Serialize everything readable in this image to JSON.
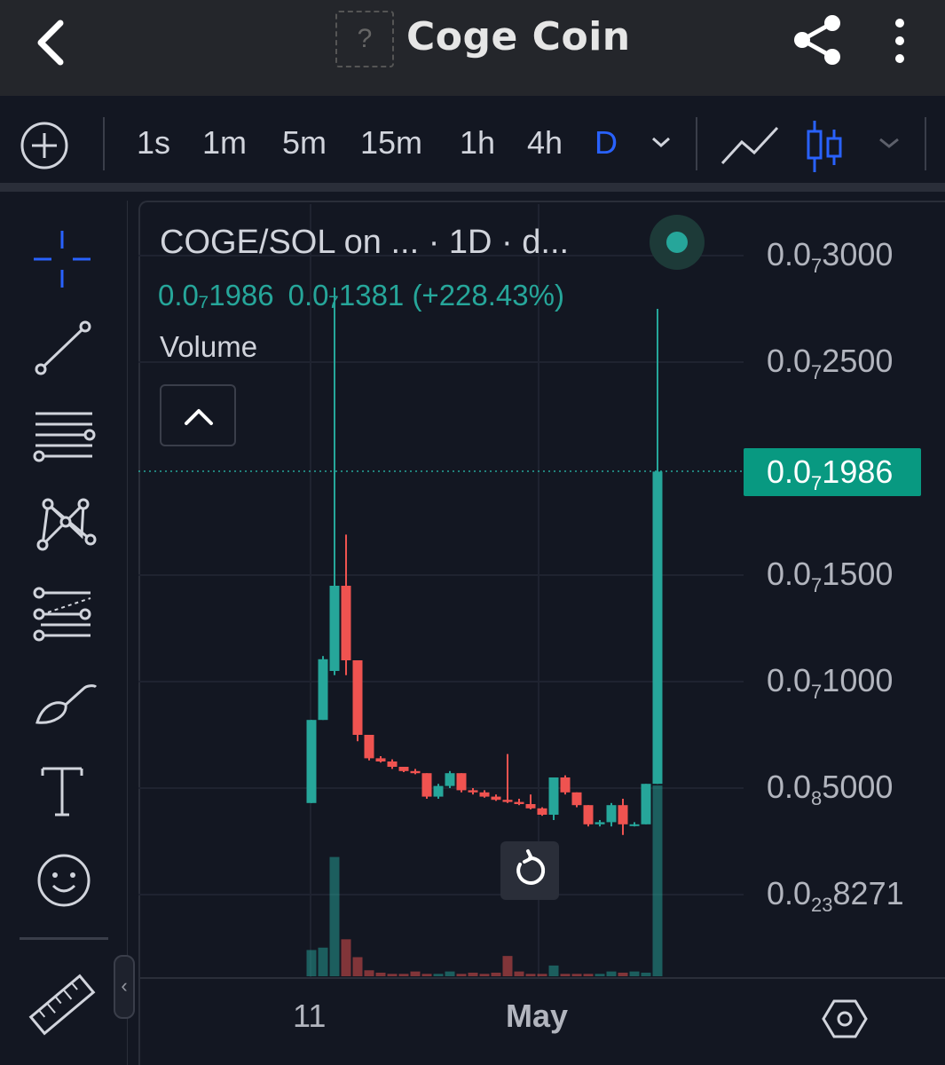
{
  "header": {
    "logo_placeholder": "?",
    "title": "Coge Coin",
    "back_icon": "chevron-left-icon",
    "share_icon": "share-icon",
    "more_icon": "more-vertical-icon"
  },
  "toolbar": {
    "timeframes": [
      "1s",
      "1m",
      "5m",
      "15m",
      "1h",
      "4h",
      "D"
    ],
    "active_timeframe": "D"
  },
  "sidebar": {
    "tools": [
      "crosshair",
      "trend-line",
      "horizontal-lines",
      "pattern",
      "fib-retracement",
      "brush",
      "text",
      "emoji",
      "ruler"
    ],
    "active_tool": "crosshair"
  },
  "legend": {
    "title": "COGE/SOL on ...   · 1D · d...",
    "close_value": "0.0₇1986",
    "change_value": "0.0₇1381 (+228.43%)",
    "volume_label": "Volume"
  },
  "price_axis": {
    "labels": [
      {
        "base": "0.0",
        "sub": "7",
        "rest": "3000"
      },
      {
        "base": "0.0",
        "sub": "7",
        "rest": "2500"
      },
      {
        "base": "0.0",
        "sub": "7",
        "rest": "1500"
      },
      {
        "base": "0.0",
        "sub": "7",
        "rest": "1000"
      },
      {
        "base": "0.0",
        "sub": "8",
        "rest": "5000"
      },
      {
        "base": "0.0",
        "sub": "23",
        "rest": "8271"
      }
    ],
    "current_price": {
      "base": "0.0",
      "sub": "7",
      "rest": "1986"
    }
  },
  "time_axis": {
    "labels": [
      "11",
      "May"
    ]
  },
  "colors": {
    "up": "#26a69a",
    "down": "#ef5350",
    "accent": "#2962ff",
    "price_tag": "#089981"
  },
  "chart_data": {
    "type": "candlestick",
    "symbol": "COGE/SOL",
    "interval": "1D",
    "ylim": [
      0,
      3e-08
    ],
    "candles": [
      {
        "o": 0.043,
        "h": 0.082,
        "l": 0.043,
        "c": 0.082
      },
      {
        "o": 0.082,
        "h": 0.112,
        "l": 0.082,
        "c": 0.1105
      },
      {
        "o": 0.105,
        "h": 0.285,
        "l": 0.103,
        "c": 0.145
      },
      {
        "o": 0.145,
        "h": 0.169,
        "l": 0.103,
        "c": 0.11
      },
      {
        "o": 0.11,
        "h": 0.11,
        "l": 0.072,
        "c": 0.075
      },
      {
        "o": 0.075,
        "h": 0.075,
        "l": 0.063,
        "c": 0.064
      },
      {
        "o": 0.064,
        "h": 0.065,
        "l": 0.062,
        "c": 0.0625
      },
      {
        "o": 0.0625,
        "h": 0.0635,
        "l": 0.059,
        "c": 0.06
      },
      {
        "o": 0.06,
        "h": 0.06,
        "l": 0.0575,
        "c": 0.058
      },
      {
        "o": 0.058,
        "h": 0.059,
        "l": 0.0565,
        "c": 0.057
      },
      {
        "o": 0.057,
        "h": 0.057,
        "l": 0.045,
        "c": 0.046
      },
      {
        "o": 0.046,
        "h": 0.052,
        "l": 0.045,
        "c": 0.051
      },
      {
        "o": 0.051,
        "h": 0.058,
        "l": 0.05,
        "c": 0.057
      },
      {
        "o": 0.057,
        "h": 0.057,
        "l": 0.048,
        "c": 0.049
      },
      {
        "o": 0.049,
        "h": 0.05,
        "l": 0.047,
        "c": 0.048
      },
      {
        "o": 0.048,
        "h": 0.049,
        "l": 0.0455,
        "c": 0.046
      },
      {
        "o": 0.046,
        "h": 0.047,
        "l": 0.044,
        "c": 0.0445
      },
      {
        "o": 0.0445,
        "h": 0.066,
        "l": 0.043,
        "c": 0.0435
      },
      {
        "o": 0.0435,
        "h": 0.045,
        "l": 0.042,
        "c": 0.0425
      },
      {
        "o": 0.0425,
        "h": 0.047,
        "l": 0.04,
        "c": 0.0405
      },
      {
        "o": 0.0405,
        "h": 0.041,
        "l": 0.037,
        "c": 0.0375
      },
      {
        "o": 0.0375,
        "h": 0.055,
        "l": 0.035,
        "c": 0.055
      },
      {
        "o": 0.055,
        "h": 0.056,
        "l": 0.047,
        "c": 0.048
      },
      {
        "o": 0.048,
        "h": 0.048,
        "l": 0.041,
        "c": 0.042
      },
      {
        "o": 0.042,
        "h": 0.042,
        "l": 0.032,
        "c": 0.033
      },
      {
        "o": 0.033,
        "h": 0.035,
        "l": 0.032,
        "c": 0.034
      },
      {
        "o": 0.034,
        "h": 0.043,
        "l": 0.032,
        "c": 0.042
      },
      {
        "o": 0.042,
        "h": 0.045,
        "l": 0.028,
        "c": 0.033
      },
      {
        "o": 0.033,
        "h": 0.034,
        "l": 0.032,
        "c": 0.033
      },
      {
        "o": 0.033,
        "h": 0.052,
        "l": 0.033,
        "c": 0.052
      },
      {
        "o": 0.052,
        "h": 0.275,
        "l": 0.052,
        "c": 0.1986
      }
    ],
    "candle_scale": "× 1e-7 SOL",
    "volumes": [
      0.22,
      0.24,
      1.0,
      0.31,
      0.16,
      0.05,
      0.03,
      0.02,
      0.02,
      0.04,
      0.02,
      0.02,
      0.04,
      0.02,
      0.03,
      0.02,
      0.03,
      0.17,
      0.04,
      0.02,
      0.02,
      0.09,
      0.02,
      0.02,
      0.02,
      0.02,
      0.04,
      0.03,
      0.04,
      0.03,
      1.6
    ],
    "current_price": "0.0₇1986",
    "change_percent": "+228.43%"
  }
}
